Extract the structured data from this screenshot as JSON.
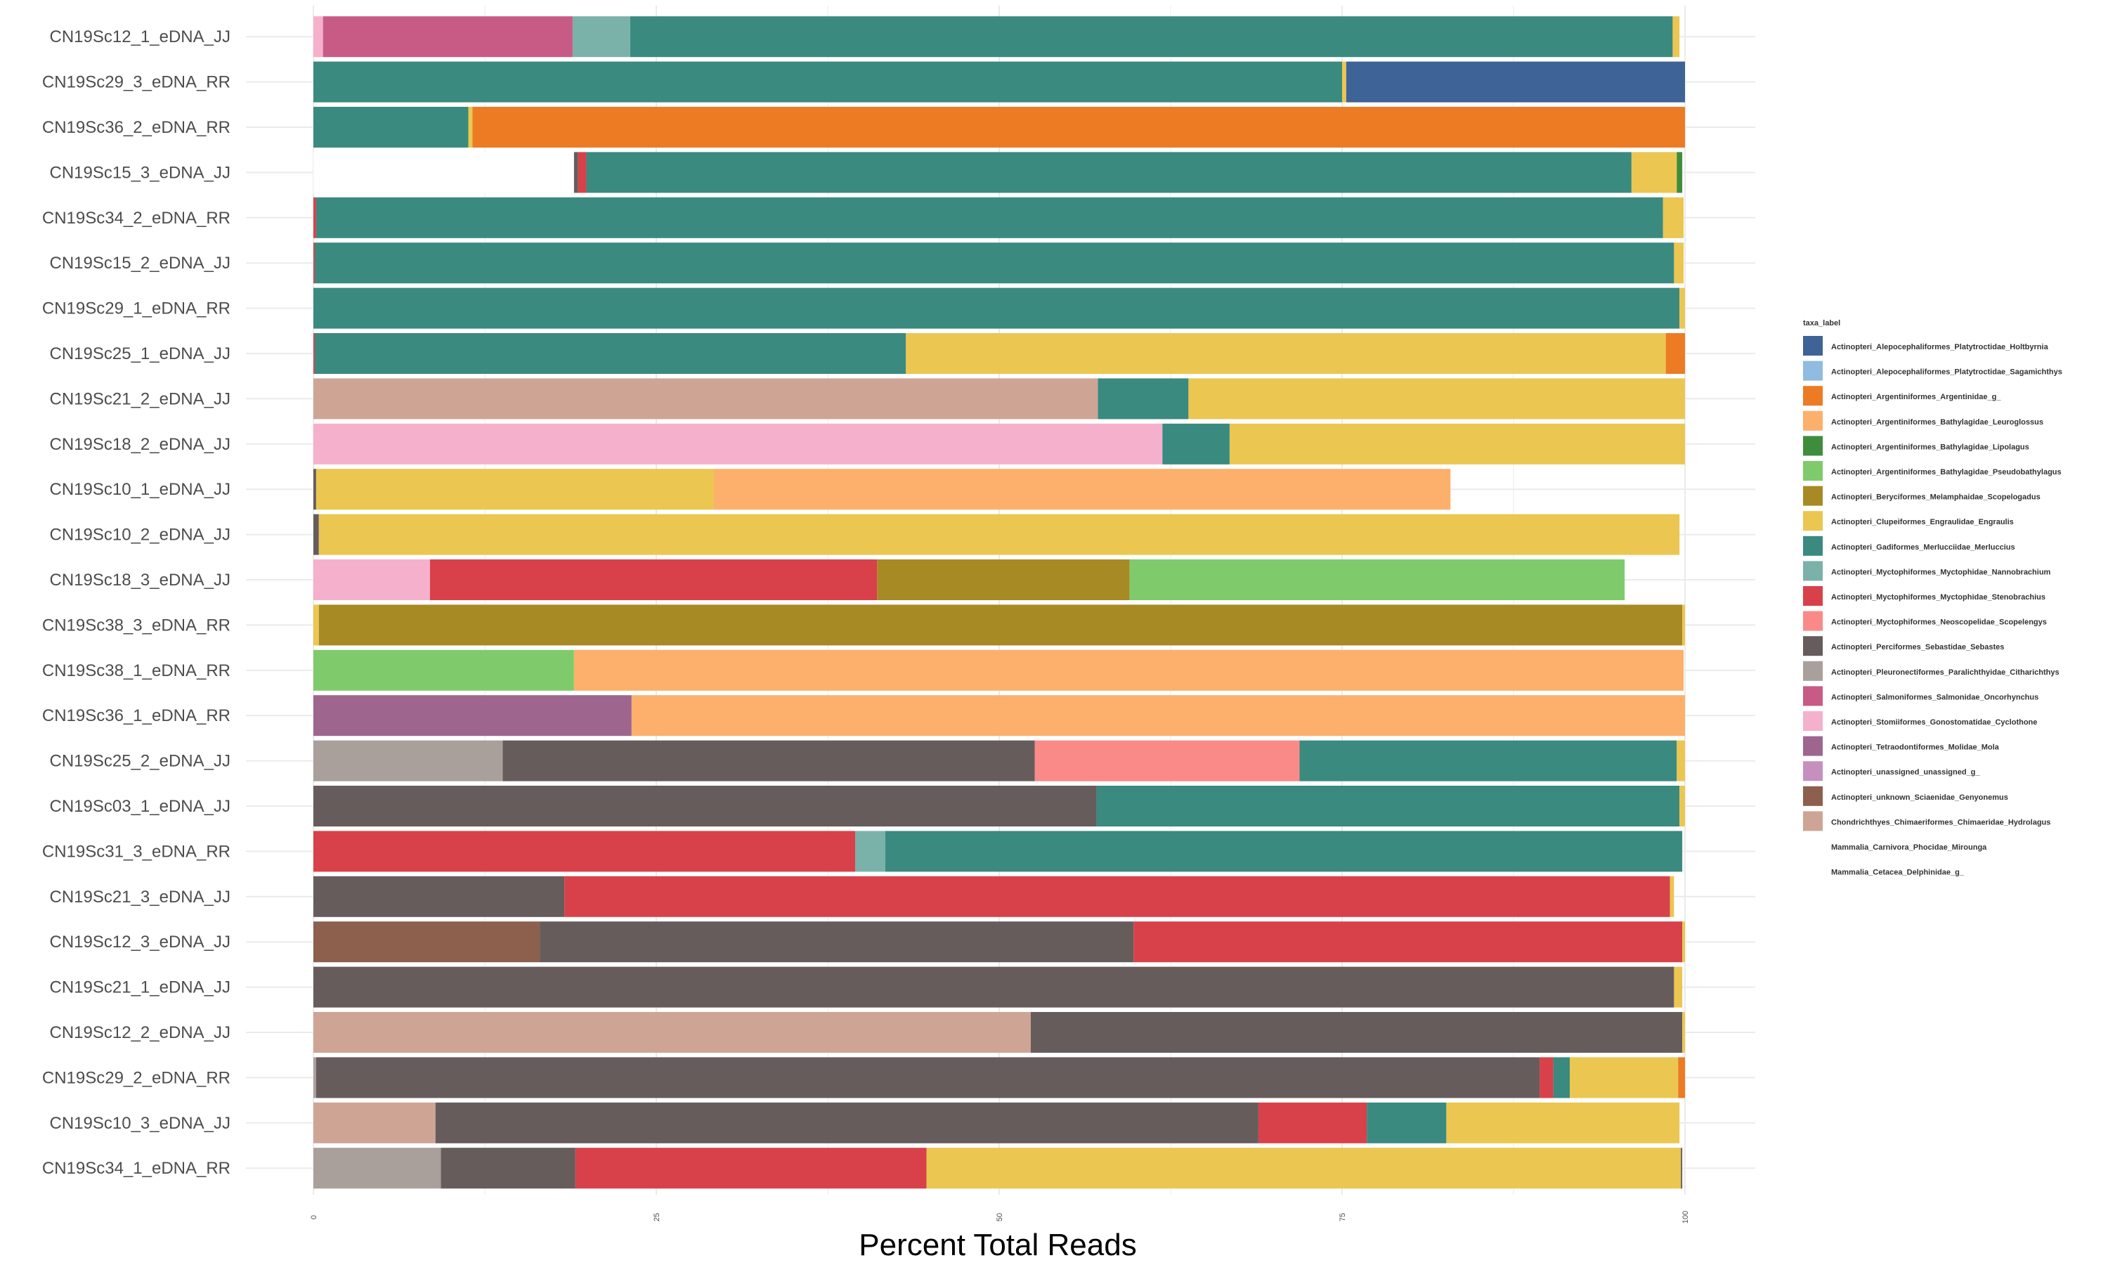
{
  "chart_data": {
    "type": "bar",
    "orientation": "horizontal",
    "stacked": true,
    "xlabel": "Percent Total Reads",
    "ylabel": "",
    "xlim": [
      0,
      100
    ],
    "xticks": [
      "0",
      "25",
      "50",
      "75",
      "100"
    ],
    "grid": true,
    "legend_position": "right",
    "legend_title": "taxa_label",
    "legend": [
      {
        "label": "Actinopteri_Alepocephaliformes_Platytroctidae_Holtbyrnia",
        "color": "#3E6396"
      },
      {
        "label": "Actinopteri_Alepocephaliformes_Platytroctidae_Sagamichthys",
        "color": "#8FBCE0"
      },
      {
        "label": "Actinopteri_Argentiniformes_Argentinidae_g_",
        "color": "#EC7B24"
      },
      {
        "label": "Actinopteri_Argentiniformes_Bathylagidae_Leuroglossus",
        "color": "#FCB06C"
      },
      {
        "label": "Actinopteri_Argentiniformes_Bathylagidae_Lipolagus",
        "color": "#3F8D3C"
      },
      {
        "label": "Actinopteri_Argentiniformes_Bathylagidae_Pseudobathylagus",
        "color": "#7FCB6B"
      },
      {
        "label": "Actinopteri_Beryciformes_Melamphaidae_Scopelogadus",
        "color": "#A88A24"
      },
      {
        "label": "Actinopteri_Clupeiformes_Engraulidae_Engraulis",
        "color": "#EBC651"
      },
      {
        "label": "Actinopteri_Gadiformes_Merlucciidae_Merluccius",
        "color": "#3A8A80"
      },
      {
        "label": "Actinopteri_Myctophiformes_Myctophidae_Nannobrachium",
        "color": "#7AB2A9"
      },
      {
        "label": "Actinopteri_Myctophiformes_Myctophidae_Stenobrachius",
        "color": "#D84149"
      },
      {
        "label": "Actinopteri_Myctophiformes_Neoscopelidae_Scopelengys",
        "color": "#FA8A88"
      },
      {
        "label": "Actinopteri_Perciformes_Sebastidae_Sebastes",
        "color": "#675C5C"
      },
      {
        "label": "Actinopteri_Pleuronectiformes_Paralichthyidae_Citharichthys",
        "color": "#A9A09C"
      },
      {
        "label": "Actinopteri_Salmoniformes_Salmonidae_Oncorhynchus",
        "color": "#C85B85"
      },
      {
        "label": "Actinopteri_Stomiiformes_Gonostomatidae_Cyclothone",
        "color": "#F5B1CB"
      },
      {
        "label": "Actinopteri_Tetraodontiformes_Molidae_Mola",
        "color": "#9E668F"
      },
      {
        "label": "Actinopteri_unassigned_unassigned_g_",
        "color": "#C690BE"
      },
      {
        "label": "Actinopteri_unknown_Sciaenidae_Genyonemus",
        "color": "#8C604D"
      },
      {
        "label": "Chondrichthyes_Chimaeriformes_Chimaeridae_Hydrolagus",
        "color": "#CEA595"
      },
      {
        "label": "Mammalia_Carnivora_Phocidae_Mirounga",
        "color": "#FFFFFF"
      },
      {
        "label": "Mammalia_Cetacea_Delphinidae_g_",
        "color": "#FFFFFF"
      }
    ],
    "categories": [
      "CN19Sc12_1_eDNA_JJ",
      "CN19Sc29_3_eDNA_RR",
      "CN19Sc36_2_eDNA_RR",
      "CN19Sc15_3_eDNA_JJ",
      "CN19Sc34_2_eDNA_RR",
      "CN19Sc15_2_eDNA_JJ",
      "CN19Sc29_1_eDNA_RR",
      "CN19Sc25_1_eDNA_JJ",
      "CN19Sc21_2_eDNA_JJ",
      "CN19Sc18_2_eDNA_JJ",
      "CN19Sc10_1_eDNA_JJ",
      "CN19Sc10_2_eDNA_JJ",
      "CN19Sc18_3_eDNA_JJ",
      "CN19Sc38_3_eDNA_RR",
      "CN19Sc38_1_eDNA_RR",
      "CN19Sc36_1_eDNA_RR",
      "CN19Sc25_2_eDNA_JJ",
      "CN19Sc03_1_eDNA_JJ",
      "CN19Sc31_3_eDNA_RR",
      "CN19Sc21_3_eDNA_JJ",
      "CN19Sc12_3_eDNA_JJ",
      "CN19Sc21_1_eDNA_JJ",
      "CN19Sc12_2_eDNA_JJ",
      "CN19Sc29_2_eDNA_RR",
      "CN19Sc10_3_eDNA_JJ",
      "CN19Sc34_1_eDNA_RR"
    ],
    "segments": [
      [
        [
          "#F5B1CB",
          0.7
        ],
        [
          "#C85B85",
          18.2
        ],
        [
          "#7AB2A9",
          4.2
        ],
        [
          "#3A8A80",
          76.0
        ],
        [
          "#EBC651",
          0.5
        ]
      ],
      [
        [
          "#3A8A80",
          75.0
        ],
        [
          "#EBC651",
          0.3
        ],
        [
          "#3E6396",
          24.7
        ]
      ],
      [
        [
          "#3A8A80",
          11.3
        ],
        [
          "#EBC651",
          0.3
        ],
        [
          "#EC7B24",
          88.4
        ]
      ],
      [
        [
          "#FFFFFF",
          19.0
        ],
        [
          "#675C5C",
          0.3
        ],
        [
          "#D84149",
          0.6
        ],
        [
          "#3A8A80",
          76.2
        ],
        [
          "#EBC651",
          3.3
        ],
        [
          "#3F8D3C",
          0.4
        ]
      ],
      [
        [
          "#D84149",
          0.2
        ],
        [
          "#3A8A80",
          98.2
        ],
        [
          "#EBC651",
          1.5
        ]
      ],
      [
        [
          "#D84149",
          0.1
        ],
        [
          "#3A8A80",
          99.1
        ],
        [
          "#EBC651",
          0.7
        ]
      ],
      [
        [
          "#3A8A80",
          99.6
        ],
        [
          "#EBC651",
          0.4
        ]
      ],
      [
        [
          "#D84149",
          0.1
        ],
        [
          "#3A8A80",
          43.1
        ],
        [
          "#EBC651",
          55.4
        ],
        [
          "#EC7B24",
          1.4
        ]
      ],
      [
        [
          "#CEA595",
          57.2
        ],
        [
          "#3A8A80",
          6.6
        ],
        [
          "#EBC651",
          36.2
        ]
      ],
      [
        [
          "#F5B1CB",
          61.9
        ],
        [
          "#3A8A80",
          4.9
        ],
        [
          "#EBC651",
          33.2
        ]
      ],
      [
        [
          "#675C5C",
          0.2
        ],
        [
          "#EBC651",
          29.0
        ],
        [
          "#FCB06C",
          53.7
        ]
      ],
      [
        [
          "#675C5C",
          0.4
        ],
        [
          "#EBC651",
          99.2
        ]
      ],
      [
        [
          "#F5B1CB",
          8.5
        ],
        [
          "#D84149",
          32.6
        ],
        [
          "#A88A24",
          18.4
        ],
        [
          "#7FCB6B",
          36.1
        ]
      ],
      [
        [
          "#EBC651",
          0.4
        ],
        [
          "#A88A24",
          99.4
        ],
        [
          "#EBC651",
          0.2
        ]
      ],
      [
        [
          "#7FCB6B",
          19.0
        ],
        [
          "#FCB06C",
          80.9
        ]
      ],
      [
        [
          "#9E668F",
          23.2
        ],
        [
          "#FCB06C",
          76.8
        ]
      ],
      [
        [
          "#A9A09C",
          13.8
        ],
        [
          "#675C5C",
          38.8
        ],
        [
          "#FA8A88",
          19.3
        ],
        [
          "#3A8A80",
          27.5
        ],
        [
          "#EBC651",
          0.6
        ]
      ],
      [
        [
          "#675C5C",
          57.1
        ],
        [
          "#3A8A80",
          42.5
        ],
        [
          "#EBC651",
          0.4
        ]
      ],
      [
        [
          "#D84149",
          39.5
        ],
        [
          "#7AB2A9",
          2.2
        ],
        [
          "#3A8A80",
          58.1
        ]
      ],
      [
        [
          "#675C5C",
          18.3
        ],
        [
          "#D84149",
          80.6
        ],
        [
          "#EBC651",
          0.3
        ]
      ],
      [
        [
          "#8C604D",
          16.5
        ],
        [
          "#675C5C",
          43.3
        ],
        [
          "#D84149",
          40.0
        ],
        [
          "#EBC651",
          0.2
        ]
      ],
      [
        [
          "#675C5C",
          99.2
        ],
        [
          "#EBC651",
          0.6
        ]
      ],
      [
        [
          "#CEA595",
          52.3
        ],
        [
          "#675C5C",
          47.5
        ],
        [
          "#EBC651",
          0.2
        ]
      ],
      [
        [
          "#A9A09C",
          0.2
        ],
        [
          "#675C5C",
          89.2
        ],
        [
          "#D84149",
          1.0
        ],
        [
          "#3A8A80",
          1.2
        ],
        [
          "#EBC651",
          7.9
        ],
        [
          "#EC7B24",
          0.5
        ]
      ],
      [
        [
          "#CEA595",
          8.9
        ],
        [
          "#675C5C",
          60.0
        ],
        [
          "#D84149",
          7.9
        ],
        [
          "#3A8A80",
          5.8
        ],
        [
          "#EBC651",
          17.0
        ]
      ],
      [
        [
          "#A9A09C",
          9.3
        ],
        [
          "#675C5C",
          9.8
        ],
        [
          "#D84149",
          25.6
        ],
        [
          "#EBC651",
          55.0
        ],
        [
          "#675C5C",
          0.1
        ]
      ]
    ]
  }
}
